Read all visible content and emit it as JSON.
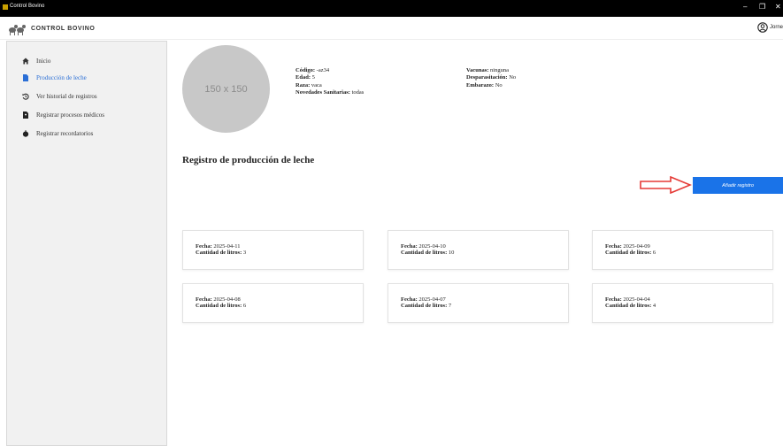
{
  "window": {
    "title": "Control Bovino",
    "minimize": "–",
    "maximize": "❐",
    "close": "✕"
  },
  "header": {
    "brand": "CONTROL BOVINO",
    "user": "Jorne"
  },
  "sidebar": {
    "items": [
      {
        "label": "Inicio",
        "icon": "home-icon"
      },
      {
        "label": "Producción de leche",
        "icon": "document-icon",
        "active": true
      },
      {
        "label": "Ver historial de registros",
        "icon": "history-icon"
      },
      {
        "label": "Registrar procesos médicos",
        "icon": "medical-file-icon"
      },
      {
        "label": "Registrar recordatorios",
        "icon": "reminder-icon"
      }
    ]
  },
  "profile": {
    "avatar_placeholder": "150 x 150",
    "col1": [
      {
        "label": "Código:",
        "value": "-az34"
      },
      {
        "label": "Edad:",
        "value": "5"
      },
      {
        "label": "Raza:",
        "value": "vaca"
      },
      {
        "label": "Novedades Sanitarias:",
        "value": "todas"
      }
    ],
    "col2": [
      {
        "label": "Vacunas:",
        "value": "ninguna"
      },
      {
        "label": "Desparasitación:",
        "value": "No"
      },
      {
        "label": "Embarazo:",
        "value": "No"
      }
    ]
  },
  "main": {
    "section_title": "Registro de producción de leche",
    "add_button": "Añadir registro",
    "accent_color": "#1a73e8",
    "arrow_color": "#e53935"
  },
  "records": [
    {
      "fecha_label": "Fecha:",
      "fecha": "2025-04-11",
      "litros_label": "Cantidad de litros:",
      "litros": "3"
    },
    {
      "fecha_label": "Fecha:",
      "fecha": "2025-04-10",
      "litros_label": "Cantidad de litros:",
      "litros": "10"
    },
    {
      "fecha_label": "Fecha:",
      "fecha": "2025-04-09",
      "litros_label": "Cantidad de litros:",
      "litros": "6"
    },
    {
      "fecha_label": "Fecha:",
      "fecha": "2025-04-08",
      "litros_label": "Cantidad de litros:",
      "litros": "6"
    },
    {
      "fecha_label": "Fecha:",
      "fecha": "2025-04-07",
      "litros_label": "Cantidad de litros:",
      "litros": "7"
    },
    {
      "fecha_label": "Fecha:",
      "fecha": "2025-04-04",
      "litros_label": "Cantidad de litros:",
      "litros": "4"
    }
  ]
}
